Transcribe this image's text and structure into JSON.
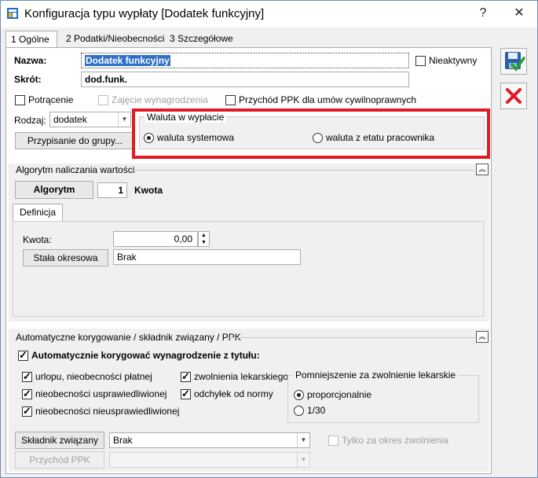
{
  "window": {
    "title": "Konfiguracja typu wypłaty [Dodatek funkcyjny]"
  },
  "titlebar": {
    "help": "?",
    "close": "✕"
  },
  "tabs": [
    {
      "label": "1 Ogólne",
      "active": true
    },
    {
      "label": "2 Podatki/Nieobecności",
      "active": false
    },
    {
      "label": "3 Szczegółowe",
      "active": false
    }
  ],
  "general": {
    "name_label": "Nazwa:",
    "name_value": "Dodatek funkcyjny",
    "short_label": "Skrót:",
    "short_value": "dod.funk.",
    "inactive_label": "Nieaktywny",
    "deduction_label": "Potrącenie",
    "seizure_label": "Zajęcie wynagrodzenia",
    "ppk_income_label": "Przychód PPK dla umów cywilnoprawnych",
    "type_label": "Rodzaj:",
    "type_value": "dodatek",
    "assign_group_button": "Przypisanie do grupy..."
  },
  "currency": {
    "title": "Waluta w wypłacie",
    "option_system": "waluta systemowa",
    "option_employee": "waluta z etatu pracownika",
    "selected": "system"
  },
  "algorithm": {
    "section_title": "Algorytm naliczania wartości",
    "button": "Algorytm",
    "number": "1",
    "name": "Kwota",
    "tab": "Definicja",
    "amount_label": "Kwota:",
    "amount_value": "0,00",
    "const_button": "Stała okresowa",
    "const_value": "Brak"
  },
  "auto": {
    "section_title": "Automatyczne korygowanie / składnik związany / PPK",
    "main_label": "Automatycznie korygować wynagrodzenie z tytułu:",
    "opt1": "urlopu, nieobecności płatnej",
    "opt2": "nieobecności usprawiedliwionej",
    "opt3": "nieobecności nieusprawiedliwionej",
    "opt4": "zwolnienia lekarskiego",
    "opt5": "odchyłek od normy",
    "reduction_title": "Pomniejszenie za zwolnienie lekarskie",
    "reduction_opt1": "proporcjonalnie",
    "reduction_opt2": "1/30",
    "linked_button": "Składnik związany",
    "linked_value": "Brak",
    "only_period_label": "Tylko za okres zwolnienia",
    "ppk_button": "Przychód PPK",
    "ppk_value": ""
  },
  "colors": {
    "accent_red": "#e01b24",
    "selection_blue": "#3070c8"
  }
}
